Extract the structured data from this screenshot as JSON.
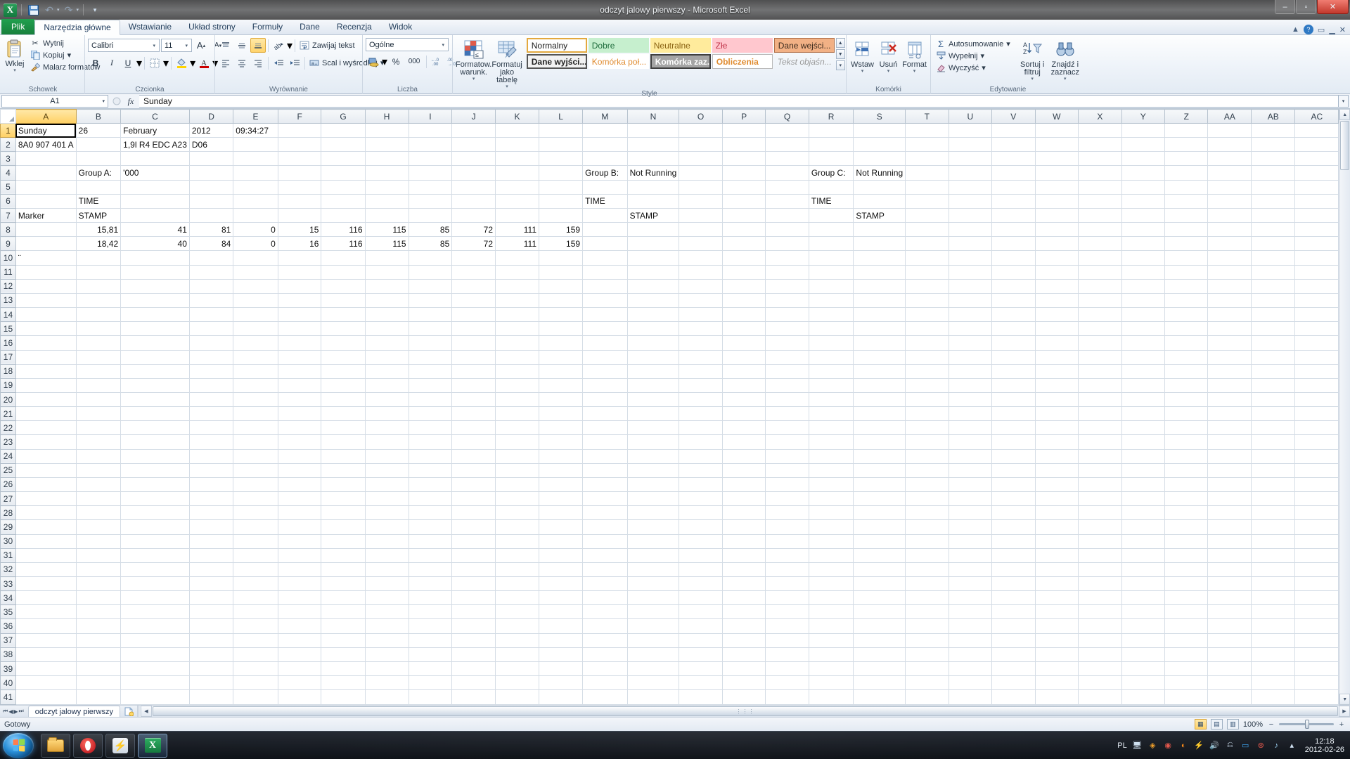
{
  "window": {
    "title": "odczyt jalowy pierwszy - Microsoft Excel",
    "minimize": "–",
    "maximize": "▫",
    "close": "✕",
    "help_icon": "?",
    "ribbon_min_icon": "▲",
    "qat": {
      "app_icon": "excel-logo-icon",
      "save": "save-icon",
      "undo": "↶",
      "redo": "↷",
      "customize": "▾"
    }
  },
  "tabs": [
    {
      "label": "Plik",
      "kind": "file"
    },
    {
      "label": "Narzędzia główne",
      "kind": "active"
    },
    {
      "label": "Wstawianie",
      "kind": "normal"
    },
    {
      "label": "Układ strony",
      "kind": "normal"
    },
    {
      "label": "Formuły",
      "kind": "normal"
    },
    {
      "label": "Dane",
      "kind": "normal"
    },
    {
      "label": "Recenzja",
      "kind": "normal"
    },
    {
      "label": "Widok",
      "kind": "normal"
    }
  ],
  "ribbon": {
    "groups": [
      {
        "name": "Schowek",
        "label": "Schowek"
      },
      {
        "name": "Czcionka",
        "label": "Czcionka"
      },
      {
        "name": "Wyrownanie",
        "label": "Wyrównanie"
      },
      {
        "name": "Liczba",
        "label": "Liczba"
      },
      {
        "name": "Style",
        "label": "Style"
      },
      {
        "name": "Komorki",
        "label": "Komórki"
      },
      {
        "name": "Edytowanie",
        "label": "Edytowanie"
      }
    ],
    "clipboard": {
      "paste": "Wklej",
      "paste_caret": "▾",
      "cut": "Wytnij",
      "copy": "Kopiuj",
      "copy_caret": "▾",
      "format_painter": "Malarz formatów"
    },
    "font": {
      "font_name": "Calibri",
      "font_size": "11",
      "grow_font": "A",
      "shrink_font": "A",
      "bold": "B",
      "italic": "I",
      "underline": "U",
      "underline_caret": "▾",
      "borders_caret": "▾",
      "fill_caret": "▾",
      "color_caret": "▾",
      "dialog_launcher": "◢"
    },
    "alignment": {
      "wrap_text": "Zawijaj tekst",
      "merge_center": "Scal i wyśrodkuj",
      "merge_caret": "▾",
      "orientation_caret": "▾",
      "dialog_launcher": "◢"
    },
    "number": {
      "format": "Ogólne",
      "format_caret": "▾",
      "currency_caret": "▾",
      "percent": "%",
      "comma": "000",
      "increase_decimal": "↞",
      "decrease_decimal": "↠",
      "dialog_launcher": "◢"
    },
    "styles": {
      "conditional_formatting": "Formatow. warunk.",
      "conditional_caret": "▾",
      "format_as_table": "Formatuj jako tabelę",
      "table_caret": "▾",
      "gallery": [
        {
          "label": "Normalny",
          "style": "s-normal"
        },
        {
          "label": "Dobre",
          "style": "s-dobre"
        },
        {
          "label": "Neutralne",
          "style": "s-neutralne"
        },
        {
          "label": "Złe",
          "style": "s-zle"
        },
        {
          "label": "Dane wejści...",
          "style": "s-wejsci"
        },
        {
          "label": "Dane wyjści...",
          "style": "s-wyjsci"
        },
        {
          "label": "Komórka poł...",
          "style": "s-polaczona"
        },
        {
          "label": "Komórka zaz...",
          "style": "s-zaznaczona"
        },
        {
          "label": "Obliczenia",
          "style": "s-obliczenia"
        },
        {
          "label": "Tekst objaśn...",
          "style": "s-objasn"
        }
      ],
      "scroll_up": "▲",
      "scroll_down": "▼",
      "scroll_more": "▾"
    },
    "cells": {
      "insert": "Wstaw",
      "insert_caret": "▾",
      "delete": "Usuń",
      "delete_caret": "▾",
      "format": "Format",
      "format_caret": "▾"
    },
    "editing": {
      "autosum": "Autosumowanie",
      "autosum_caret": "▾",
      "fill": "Wypełnij",
      "fill_caret": "▾",
      "clear": "Wyczyść",
      "clear_caret": "▾",
      "sort_filter": "Sortuj i filtruj",
      "sort_caret": "▾",
      "find_select": "Znajdź i zaznacz",
      "find_caret": "▾"
    }
  },
  "formula_bar": {
    "name_box": "A1",
    "name_caret": "▾",
    "cancel": "✕",
    "enter": "✓",
    "insert_function": "fx",
    "value": "Sunday",
    "expand": "▾"
  },
  "sheet": {
    "columns": [
      "A",
      "B",
      "C",
      "D",
      "E",
      "F",
      "G",
      "H",
      "I",
      "J",
      "K",
      "L",
      "M",
      "N",
      "O",
      "P",
      "Q",
      "R",
      "S",
      "T",
      "U",
      "V",
      "W",
      "X",
      "Y",
      "Z",
      "AA",
      "AB",
      "AC"
    ],
    "selected_column": "A",
    "selected_row": 1,
    "row_count": 41,
    "cells": {
      "1": {
        "A": "Sunday",
        "B": "26",
        "C": "February",
        "D": "2012",
        "E": "09:34:27"
      },
      "2": {
        "A": "8A0 907 401 A",
        "C": "1,9l R4 EDC A23",
        "D": "D06"
      },
      "4": {
        "B": "Group A:",
        "C": "'000",
        "M": "Group B:",
        "N": "Not Running",
        "R": "Group C:",
        "S": "Not Running"
      },
      "6": {
        "B": "TIME",
        "M": "TIME",
        "R": "TIME"
      },
      "7": {
        "A": "Marker",
        "B": "STAMP",
        "N": "STAMP",
        "S": "STAMP"
      },
      "8": {
        "B": "15,81",
        "C": "41",
        "D": "81",
        "E": "0",
        "F": "15",
        "G": "116",
        "H": "115",
        "I": "85",
        "J": "72",
        "K": "111",
        "L": "159"
      },
      "9": {
        "B": "18,42",
        "C": "40",
        "D": "84",
        "E": "0",
        "F": "16",
        "G": "116",
        "H": "115",
        "I": "85",
        "J": "72",
        "K": "111",
        "L": "159"
      },
      "10": {
        "A": "¨"
      }
    },
    "numeric_cols": [
      "B",
      "C",
      "D",
      "E",
      "F",
      "G",
      "H",
      "I",
      "J",
      "K",
      "L"
    ],
    "text_rows": [
      "1",
      "2",
      "4",
      "6",
      "7",
      "10"
    ]
  },
  "sheet_tabs": {
    "first": "⏮",
    "prev": "◀",
    "next": "▶",
    "last": "⏭",
    "active_sheet": "odczyt jalowy pierwszy",
    "new_sheet_icon": "new-sheet-icon"
  },
  "status_bar": {
    "status": "Gotowy",
    "view_normal": "▦",
    "view_layout": "▤",
    "view_pagebreak": "▥",
    "zoom_level": "100%",
    "zoom_out": "−",
    "zoom_in": "+"
  },
  "taskbar": {
    "start": "start-orb",
    "items": [
      {
        "name": "explorer",
        "icon": "folder-icon",
        "active": false
      },
      {
        "name": "opera",
        "icon": "opera-icon",
        "active": false
      },
      {
        "name": "flash",
        "icon": "lightning-icon",
        "active": false
      },
      {
        "name": "excel",
        "icon": "excel-icon",
        "active": true
      }
    ],
    "tray": {
      "language": "PL",
      "icons": [
        "monitor-icon",
        "shield-icon",
        "network-icon",
        "firefox-icon",
        "bolt-icon",
        "volume-icon",
        "battery-icon",
        "usb-icon",
        "clock-sync-icon",
        "sound-icon",
        "chevron-up-icon"
      ],
      "time": "12:18",
      "date": "2012-02-26"
    }
  }
}
